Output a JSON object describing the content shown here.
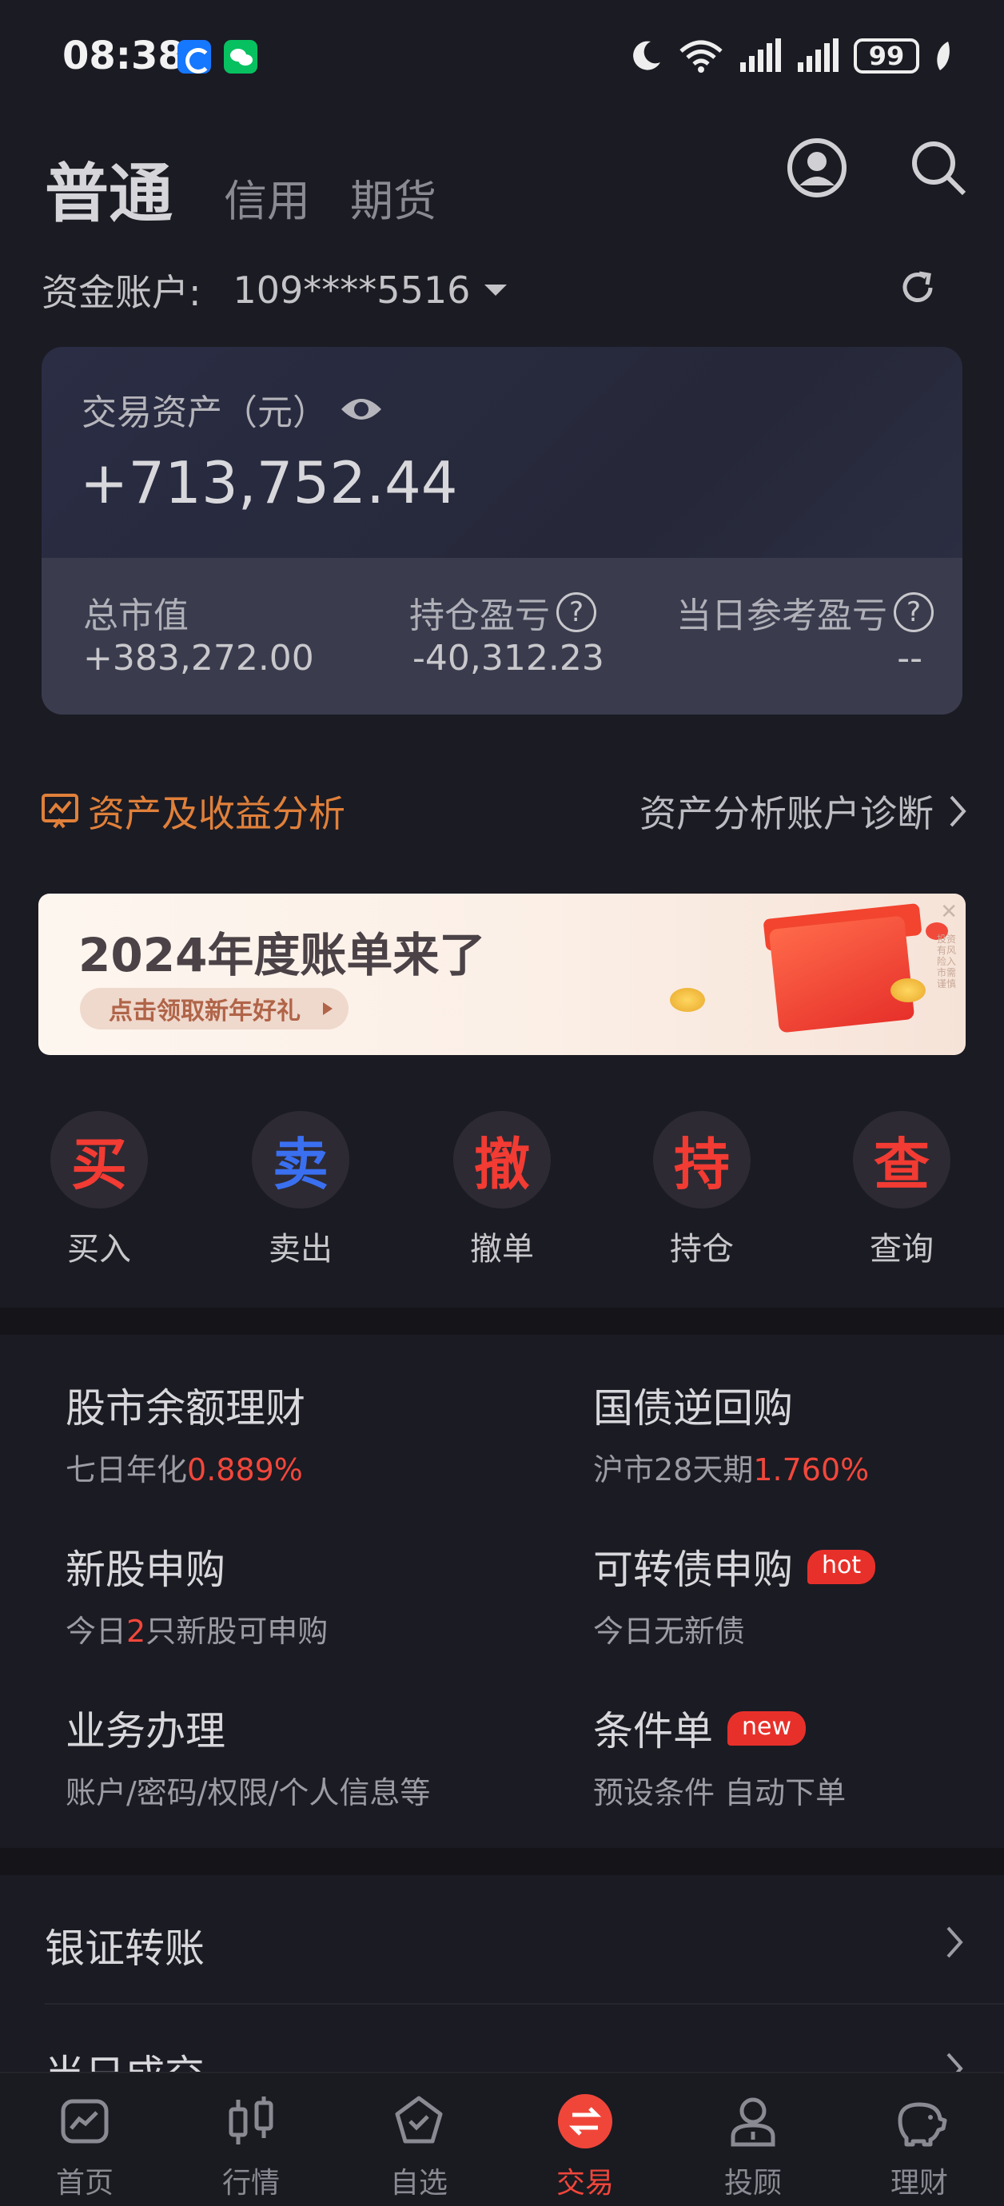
{
  "status_bar": {
    "time": "08:38",
    "battery": "99"
  },
  "header": {
    "tabs": [
      {
        "label": "普通",
        "active": true
      },
      {
        "label": "信用",
        "active": false
      },
      {
        "label": "期货",
        "active": false
      }
    ],
    "icons": [
      "user-icon",
      "search-icon"
    ]
  },
  "account": {
    "label": "资金账户:",
    "number": "109****5516"
  },
  "assets": {
    "label": "交易资产（元）",
    "total": "+713,752.44",
    "market_value_label": "总市值",
    "market_value": "+383,272.00",
    "position_pnl_label": "持仓盈亏",
    "position_pnl": "-40,312.23",
    "daily_pnl_label": "当日参考盈亏",
    "daily_pnl": "--"
  },
  "analysis": {
    "left_label": "资产及收益分析",
    "right_label": "资产分析账户诊断"
  },
  "banner": {
    "title": "2024年度账单来了",
    "button": "点击领取新年好礼",
    "side_text": "投资有风险入市需谨慎",
    "colors": {
      "accent": "#e8302a"
    }
  },
  "actions": [
    {
      "glyph": "买",
      "label": "买入",
      "color": "#f23b33"
    },
    {
      "glyph": "卖",
      "label": "卖出",
      "color": "#3a6ff0"
    },
    {
      "glyph": "撤",
      "label": "撤单",
      "color": "#f23b33"
    },
    {
      "glyph": "持",
      "label": "持仓",
      "color": "#f23b33"
    },
    {
      "glyph": "查",
      "label": "查询",
      "color": "#f23b33"
    }
  ],
  "services": {
    "money_fund": {
      "title": "股市余额理财",
      "sub_prefix": "七日年化",
      "sub_value": "0.889%"
    },
    "repo": {
      "title": "国债逆回购",
      "sub_prefix": "沪市28天期",
      "sub_value": "1.760%"
    },
    "ipo": {
      "title": "新股申购",
      "sub_prefix": "今日",
      "sub_count": "2",
      "sub_suffix": "只新股可申购"
    },
    "cb": {
      "title": "可转债申购",
      "badge": "hot",
      "sub": "今日无新债"
    },
    "business": {
      "title": "业务办理",
      "sub": "账户/密码/权限/个人信息等"
    },
    "conditional": {
      "title": "条件单",
      "badge": "new",
      "sub": "预设条件 自动下单"
    }
  },
  "list": [
    {
      "label": "银证转账"
    },
    {
      "label": "当日成交"
    }
  ],
  "bottom_nav": [
    {
      "label": "首页",
      "icon": "home-chart-icon",
      "active": false
    },
    {
      "label": "行情",
      "icon": "candlestick-icon",
      "active": false
    },
    {
      "label": "自选",
      "icon": "shield-check-icon",
      "active": false
    },
    {
      "label": "交易",
      "icon": "trade-exchange-icon",
      "active": true
    },
    {
      "label": "投顾",
      "icon": "advisor-person-icon",
      "active": false
    },
    {
      "label": "理财",
      "icon": "piggy-bank-icon",
      "active": false
    }
  ]
}
